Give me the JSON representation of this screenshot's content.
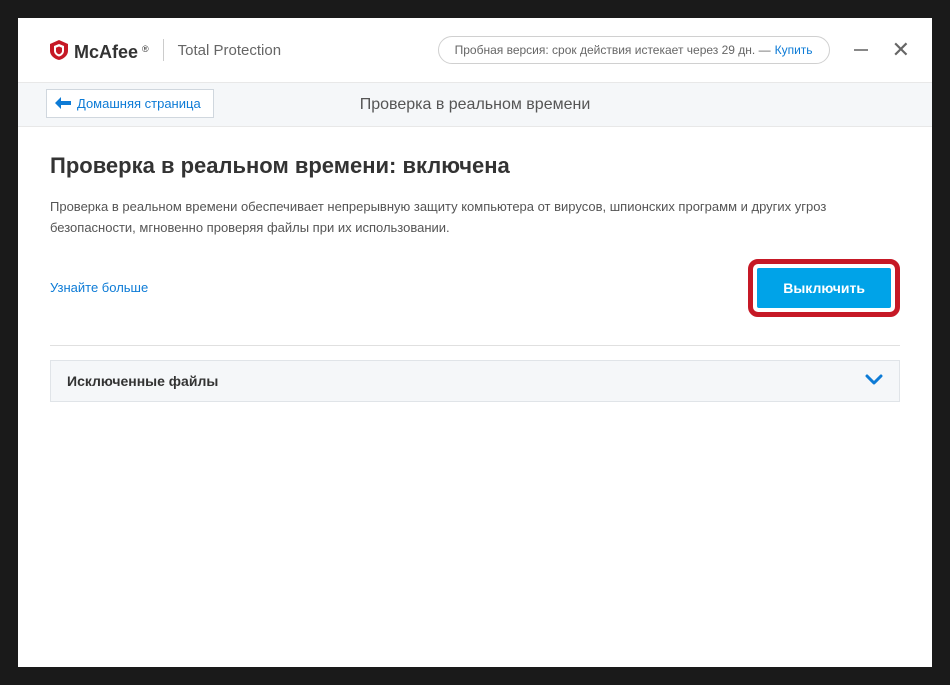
{
  "brand": {
    "name": "McAfee",
    "registered": "®",
    "product": "Total Protection"
  },
  "trial": {
    "text": "Пробная версия: срок действия истекает через 29 дн. —",
    "buy_label": "Купить"
  },
  "nav": {
    "back_label": "Домашняя страница",
    "page_title": "Проверка в реальном времени"
  },
  "main": {
    "heading": "Проверка в реальном времени: включена",
    "description": "Проверка в реальном времени обеспечивает непрерывную защиту компьютера от вирусов, шпионских программ и других угроз безопасности, мгновенно проверяя файлы при их использовании.",
    "learn_more": "Узнайте больше",
    "disable_button": "Выключить",
    "expander_label": "Исключенные файлы"
  }
}
